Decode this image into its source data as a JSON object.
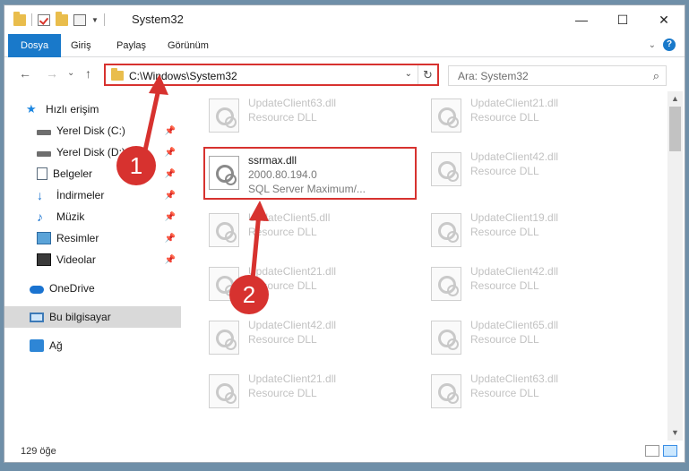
{
  "window": {
    "title": "System32",
    "controls": {
      "minimize": "—",
      "maximize": "☐",
      "close": "✕"
    }
  },
  "ribbon": {
    "tabs": [
      "Dosya",
      "Giriş",
      "Paylaş",
      "Görünüm"
    ],
    "expand": "⌄",
    "help": "?"
  },
  "address": {
    "path": "C:\\Windows\\System32",
    "search_placeholder": "Ara: System32",
    "dropdown": "⌄",
    "refresh": "↻",
    "search_icon": "⌕"
  },
  "nav": {
    "back": "←",
    "forward": "→",
    "recent": "⌄",
    "up": "↑"
  },
  "sidebar": {
    "quick_access": "Hızlı erişim",
    "items": [
      {
        "label": "Yerel Disk (C:)",
        "icon": "drive-icon",
        "pinned": true
      },
      {
        "label": "Yerel Disk (D:)",
        "icon": "drive-icon",
        "pinned": true
      },
      {
        "label": "Belgeler",
        "icon": "documents-icon",
        "pinned": true
      },
      {
        "label": "İndirmeler",
        "icon": "downloads-icon",
        "pinned": true
      },
      {
        "label": "Müzik",
        "icon": "music-icon",
        "pinned": true
      },
      {
        "label": "Resimler",
        "icon": "pictures-icon",
        "pinned": true
      },
      {
        "label": "Videolar",
        "icon": "videos-icon",
        "pinned": true
      }
    ],
    "onedrive": "OneDrive",
    "this_pc": "Bu bilgisayar",
    "network": "Ağ"
  },
  "files": {
    "left": [
      {
        "name": "UpdateClient63.dll",
        "desc": "Resource DLL"
      },
      {
        "name": "ssrmax.dll",
        "desc": "2000.80.194.0",
        "desc2": "SQL Server Maximum/...",
        "highlight": true
      },
      {
        "name": "UpdateClient5.dll",
        "desc": "Resource DLL"
      },
      {
        "name": "UpdateClient21.dll",
        "desc": "Resource DLL"
      },
      {
        "name": "UpdateClient42.dll",
        "desc": "Resource DLL"
      },
      {
        "name": "UpdateClient21.dll",
        "desc": "Resource DLL"
      }
    ],
    "right": [
      {
        "name": "UpdateClient21.dll",
        "desc": "Resource DLL"
      },
      {
        "name": "UpdateClient42.dll",
        "desc": "Resource DLL"
      },
      {
        "name": "UpdateClient19.dll",
        "desc": "Resource DLL"
      },
      {
        "name": "UpdateClient42.dll",
        "desc": "Resource DLL"
      },
      {
        "name": "UpdateClient65.dll",
        "desc": "Resource DLL"
      },
      {
        "name": "UpdateClient63.dll",
        "desc": "Resource DLL"
      }
    ]
  },
  "status": {
    "count": "129 öğe"
  },
  "annotations": {
    "step1": "1",
    "step2": "2",
    "color": "#d7322f"
  }
}
